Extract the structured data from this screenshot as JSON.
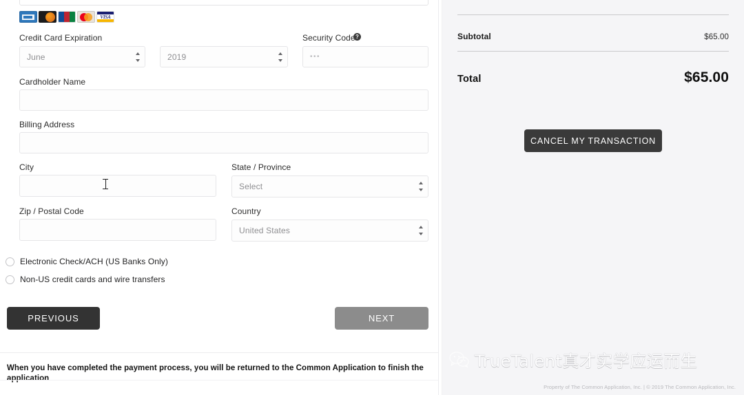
{
  "payment_form": {
    "card_icons": [
      {
        "name": "amex-card-icon",
        "label": "American Express"
      },
      {
        "name": "discover-card-icon",
        "label": "Discover"
      },
      {
        "name": "jcb-card-icon",
        "label": "JCB"
      },
      {
        "name": "mastercard-card-icon",
        "label": "Mastercard"
      },
      {
        "name": "visa-card-icon",
        "label": "VISA"
      }
    ],
    "expiration": {
      "label": "Credit Card Expiration",
      "month_value": "June",
      "year_value": "2019"
    },
    "security_code": {
      "label": "Security Code",
      "help_glyph": "?",
      "placeholder": "•••"
    },
    "cardholder_name": {
      "label": "Cardholder Name",
      "value": ""
    },
    "billing_address": {
      "label": "Billing Address",
      "value": ""
    },
    "city": {
      "label": "City",
      "value": ""
    },
    "state_province": {
      "label": "State / Province",
      "value": "Select"
    },
    "zip_postal": {
      "label": "Zip / Postal Code",
      "value": ""
    },
    "country": {
      "label": "Country",
      "value": "United States"
    },
    "alt_methods": [
      {
        "label": "Electronic Check/ACH (US Banks Only)",
        "selected": false
      },
      {
        "label": "Non-US credit cards and wire transfers",
        "selected": false
      }
    ],
    "buttons": {
      "previous": "PREVIOUS",
      "next": "NEXT"
    },
    "footnote": "When you have completed the payment process, you will be returned to the Common Application to finish the application"
  },
  "order_summary": {
    "subtotal_label": "Subtotal",
    "subtotal_value": "$65.00",
    "total_label": "Total",
    "total_value": "$65.00",
    "cancel_button": "CANCEL MY TRANSACTION"
  },
  "watermark": {
    "text": "TrueTalent真才实学应运而生",
    "logo": "wechat-logo-icon"
  },
  "footer": {
    "copyright": "Property of The Common Application, Inc. | © 2019 The Common Application, Inc."
  },
  "colors": {
    "accent_dark": "#333333",
    "next_disabled": "#8c8c8c",
    "panel_bg": "#f5f5f7"
  }
}
